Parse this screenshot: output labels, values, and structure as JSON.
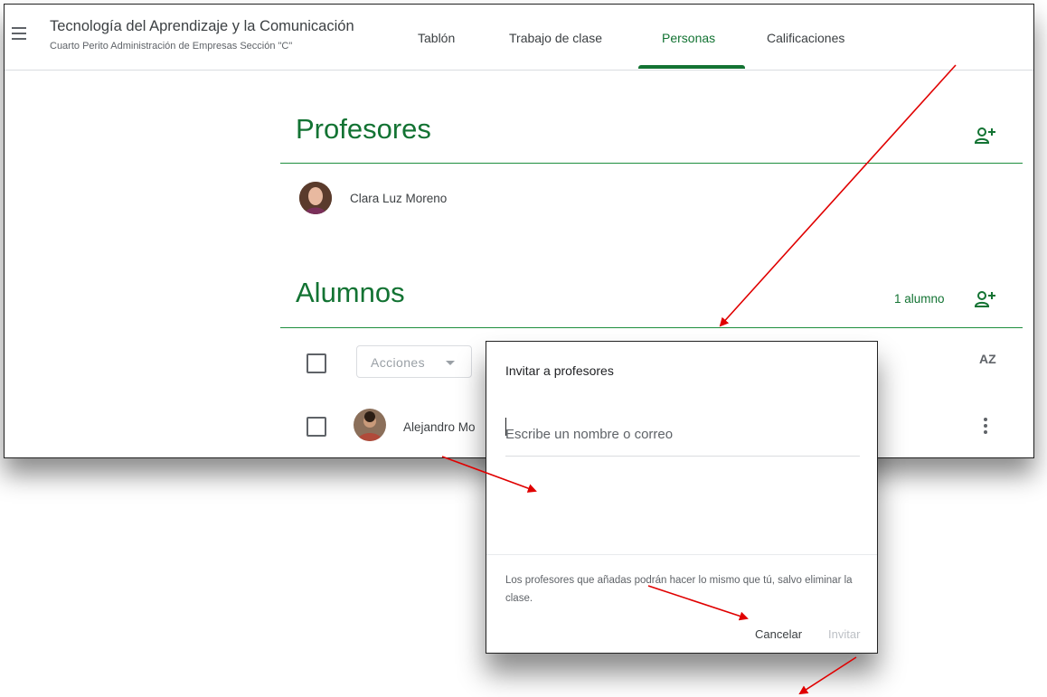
{
  "header": {
    "class_title": "Tecnología del Aprendizaje y la Comunicación",
    "class_subtitle": "Cuarto Perito Administración de Empresas Sección \"C\"",
    "tabs": [
      {
        "label": "Tablón",
        "active": false
      },
      {
        "label": "Trabajo de clase",
        "active": false
      },
      {
        "label": "Personas",
        "active": true
      },
      {
        "label": "Calificaciones",
        "active": false
      }
    ]
  },
  "teachers": {
    "title": "Profesores",
    "items": [
      {
        "name": "Clara Luz Moreno"
      }
    ]
  },
  "students": {
    "title": "Alumnos",
    "count": "1 alumno",
    "actions_label": "Acciones",
    "sort_label": "AZ",
    "items": [
      {
        "name": "Alejandro Mo"
      }
    ]
  },
  "dialog": {
    "title": "Invitar a profesores",
    "input_placeholder": "Escribe un nombre o correo",
    "note": "Los profesores que añadas podrán hacer lo mismo que tú, salvo eliminar la clase.",
    "cancel_label": "Cancelar",
    "invite_label": "Invitar"
  },
  "colors": {
    "accent": "#137333",
    "rule": "#1e8e3e",
    "annotation": "#e00000"
  }
}
